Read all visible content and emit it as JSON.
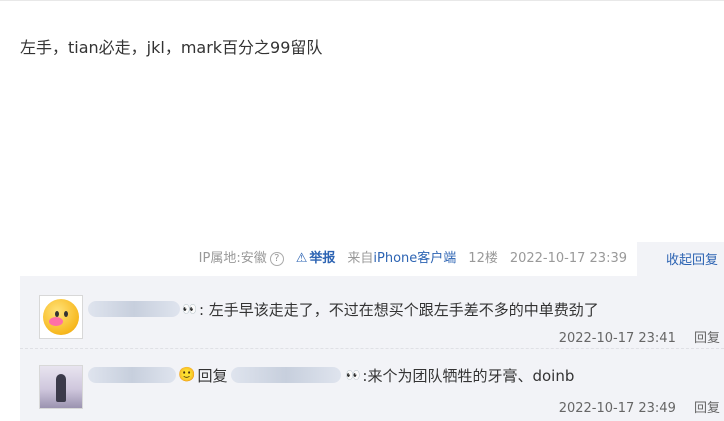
{
  "post": {
    "text": "左手，tian必走，jkl，mark百分之99留队"
  },
  "meta": {
    "ip_label": "IP属地:安徽",
    "help_icon": "?",
    "report_label": "举报",
    "device_prefix": "来自",
    "device_link": "iPhone客户端",
    "floor": "12楼",
    "timestamp": "2022-10-17 23:39",
    "collapse_label": "收起回复"
  },
  "replies": [
    {
      "username_suffix": "👀",
      "text": ": 左手早该走走了，不过在想买个跟左手差不多的中单费劲了",
      "timestamp": "2022-10-17 23:41",
      "reply_label": "回复"
    },
    {
      "username_suffix": "🙂",
      "reply_prefix": "回复",
      "target_suffix": "👀",
      "text": ":来个为团队牺牲的牙膏、doinb",
      "timestamp": "2022-10-17 23:49",
      "reply_label": "回复"
    }
  ]
}
